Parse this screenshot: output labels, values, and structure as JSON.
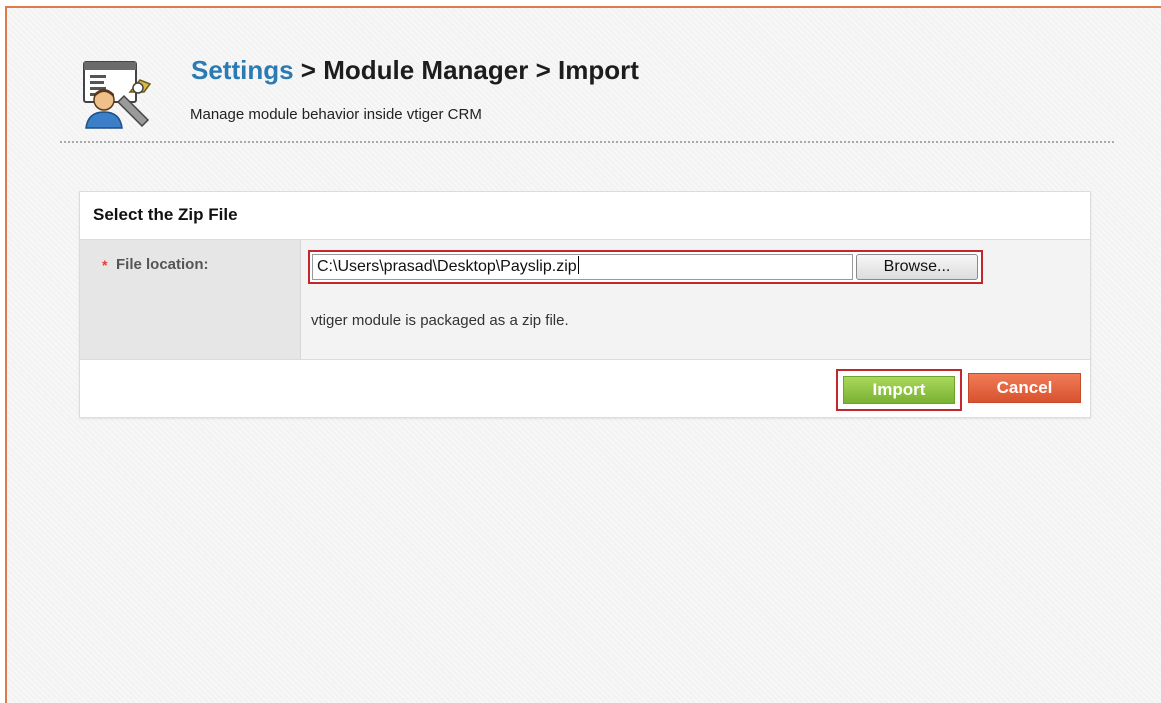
{
  "header": {
    "breadcrumb_settings": "Settings",
    "breadcrumb_sep_1": " > ",
    "breadcrumb_module_manager": "Module Manager",
    "breadcrumb_sep_2": " > ",
    "breadcrumb_import": "Import",
    "subtitle": "Manage module behavior inside vtiger CRM",
    "icon": "settings-module-icon"
  },
  "panel": {
    "heading": "Select the Zip File",
    "required_marker": "*",
    "file_label": "File location:",
    "file_value": "C:\\Users\\prasad\\Desktop\\Payslip.zip",
    "browse_label": "Browse...",
    "hint": "vtiger module is packaged as a zip file."
  },
  "actions": {
    "import_label": "Import",
    "cancel_label": "Cancel"
  },
  "colors": {
    "frame_border": "#e07a48",
    "link_blue": "#2b7bb3",
    "highlight_red": "#c2272d",
    "import_green": "#79b234",
    "cancel_orange": "#d9522f"
  }
}
